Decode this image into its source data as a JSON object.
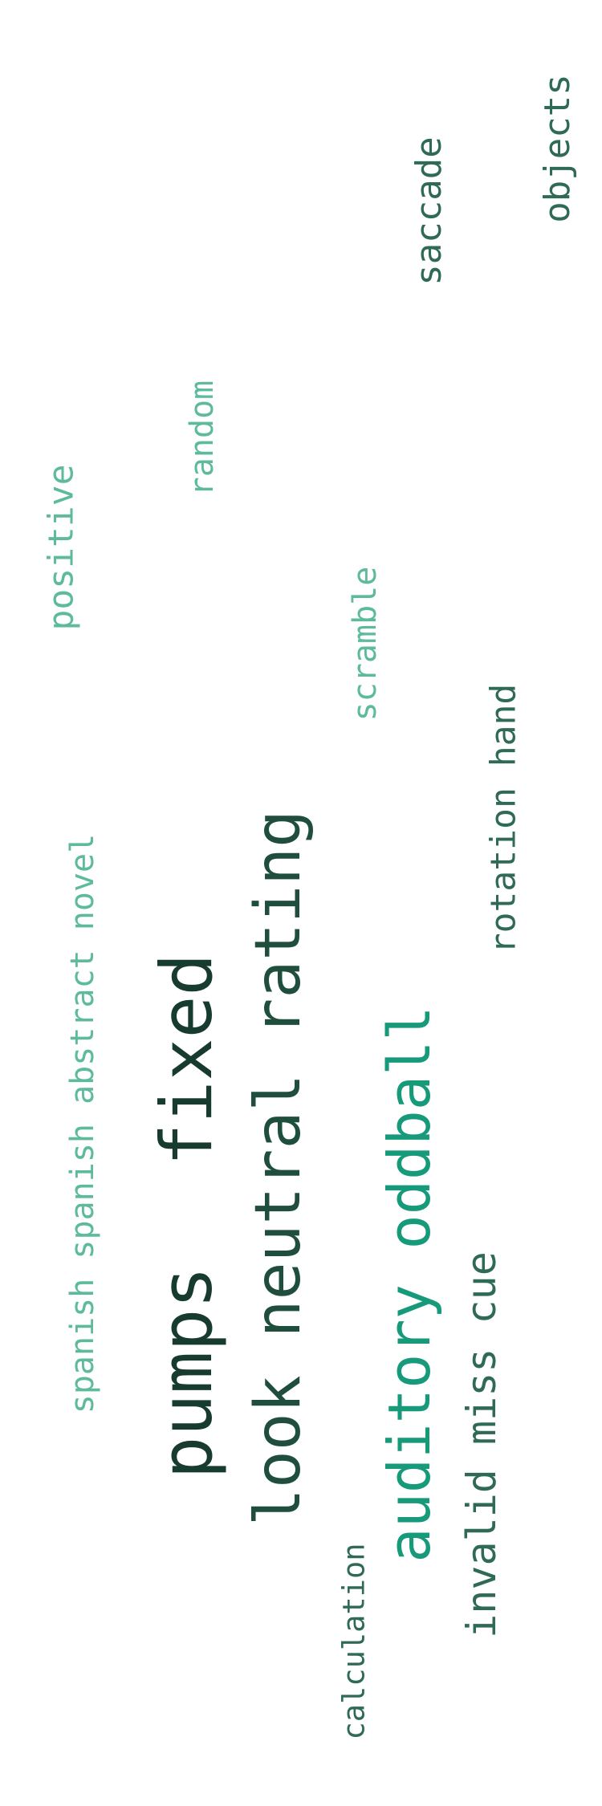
{
  "colors": {
    "background": "#ffffff",
    "dark": "#173b2e",
    "dark_green": "#1f4e3d",
    "mid_green": "#2f6a55",
    "teal": "#169a7a",
    "light_teal": "#5dba9d"
  },
  "words": {
    "pumps": "pumps",
    "fixed": "fixed",
    "look_neutral_rating": "look neutral rating",
    "auditory_oddball": "auditory oddball",
    "invalid_miss_cue": "invalid miss cue",
    "spanish_phrase": "spanish spanish abstract novel",
    "rotation_hand": "rotation hand",
    "scramble": "scramble",
    "positive": "positive",
    "random": "random",
    "saccade": "saccade",
    "objects": "objects",
    "calculation": "calculation"
  }
}
